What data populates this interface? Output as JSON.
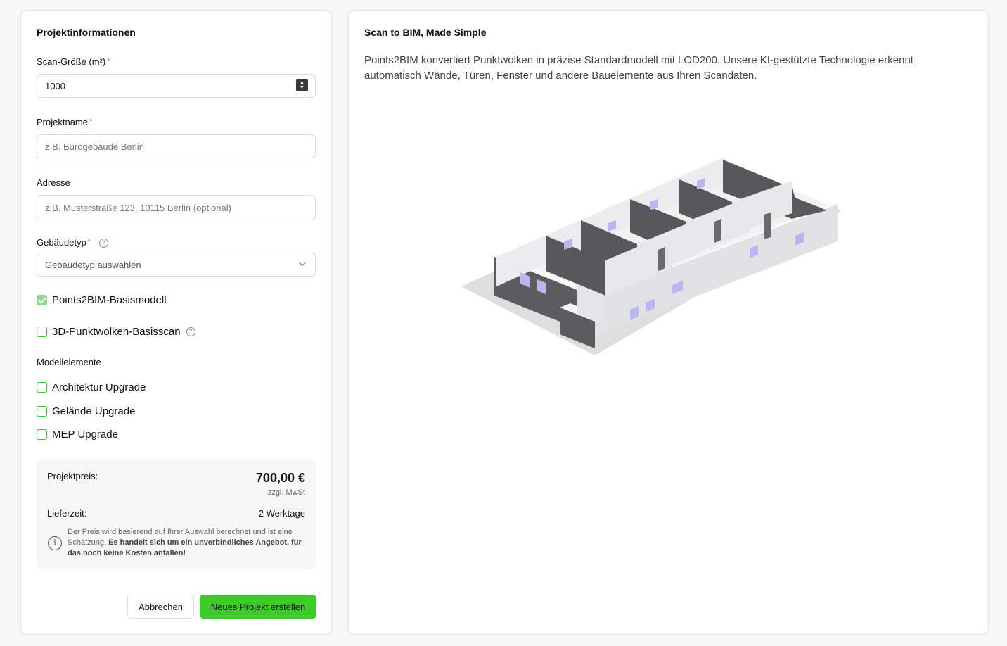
{
  "form": {
    "title": "Projektinformationen",
    "scan_size": {
      "label": "Scan-Größe (m²)",
      "required_mark": "*",
      "value": "1000"
    },
    "project_name": {
      "label": "Projektname",
      "required_mark": "*",
      "placeholder": "z.B. Bürogebäude Berlin"
    },
    "address": {
      "label": "Adresse",
      "placeholder": "z.B. Musterstraße 123, 10115 Berlin (optional)"
    },
    "building_type": {
      "label": "Gebäudetyp",
      "required_mark": "*",
      "selected": "Gebäudetyp auswählen"
    },
    "options": [
      {
        "label": "Points2BIM-Basismodell",
        "checked": true
      },
      {
        "label": "3D-Punktwolken-Basisscan",
        "checked": false
      }
    ],
    "model_elements": {
      "label": "Modellelemente",
      "items": [
        {
          "label": "Architektur Upgrade",
          "checked": false
        },
        {
          "label": "Gelände Upgrade",
          "checked": false
        },
        {
          "label": "MEP Upgrade",
          "checked": false
        }
      ]
    },
    "price": {
      "label": "Projektpreis:",
      "value": "700,00 €",
      "vat": "zzgl. MwSt",
      "delivery_label": "Lieferzeit:",
      "delivery_value": "2 Werktage",
      "note_normal": "Der Preis wird basierend auf Ihrer Auswahl berechnet und ist eine Schätzung. ",
      "note_bold": "Es handelt sich um ein unverbindliches Angebot, für das noch keine Kosten anfallen!"
    },
    "cancel_label": "Abbrechen",
    "submit_label": "Neues Projekt erstellen"
  },
  "info": {
    "title": "Scan to BIM, Made Simple",
    "description": "Points2BIM konvertiert Punktwolken in präzise Standardmodell mit LOD200. Unsere KI-gestützte Technologie erkennt automatisch Wände, Türen, Fenster und andere Bauelemente aus Ihren Scandaten."
  },
  "colors": {
    "accent_green": "#3ccc28",
    "checkbox_border": "#3cc13b",
    "wall_dark": "#5a5a5c",
    "wall_light": "#e6e6e8"
  }
}
